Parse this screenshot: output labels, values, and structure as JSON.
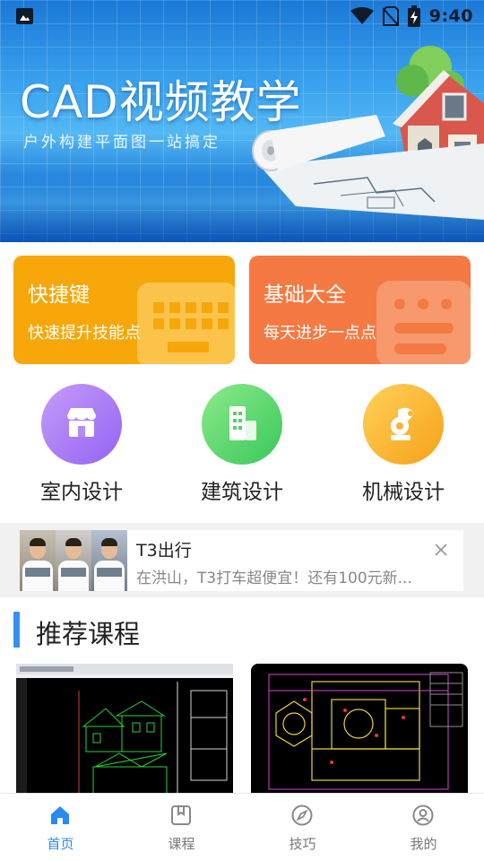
{
  "status_bar": {
    "time": "9:40",
    "icons": [
      "image-icon",
      "wifi-icon",
      "no-sim-icon",
      "battery-charging-icon"
    ]
  },
  "banner": {
    "title": "CAD视频教学",
    "subtitle": "户外构建平面图一站搞定"
  },
  "feature_cards": [
    {
      "title": "快捷键",
      "subtitle": "快速提升技能点",
      "color": "#f7a70a",
      "icon": "keyboard-icon"
    },
    {
      "title": "基础大全",
      "subtitle": "每天进步一点点",
      "color": "#f57942",
      "icon": "chat-bubble-icon"
    }
  ],
  "categories": [
    {
      "label": "室内设计",
      "icon": "storefront-icon",
      "color": "#a374f5"
    },
    {
      "label": "建筑设计",
      "icon": "building-icon",
      "color": "#4bcf66"
    },
    {
      "label": "机械设计",
      "icon": "robot-arm-icon",
      "color": "#f9b331"
    }
  ],
  "ad": {
    "title": "T3出行",
    "subtitle": "在洪山，T3打车超便宜！还有100元新..."
  },
  "recommend": {
    "title": "推荐课程"
  },
  "tabbar": {
    "tabs": [
      {
        "label": "首页",
        "icon": "home-icon",
        "active": true
      },
      {
        "label": "课程",
        "icon": "book-icon",
        "active": false
      },
      {
        "label": "技巧",
        "icon": "compass-icon",
        "active": false
      },
      {
        "label": "我的",
        "icon": "user-icon",
        "active": false
      }
    ],
    "active_color": "#2b8af1"
  }
}
